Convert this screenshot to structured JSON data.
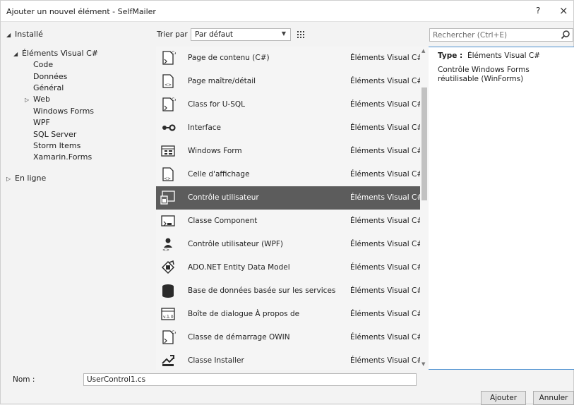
{
  "window": {
    "title": "Ajouter un nouvel élément - SelfMailer",
    "help": "?",
    "close": "×"
  },
  "tree": {
    "installed": "Installé",
    "visual_csharp": "Éléments Visual C#",
    "children": [
      "Code",
      "Données",
      "Général",
      "Web",
      "Windows Forms",
      "WPF",
      "SQL Server",
      "Storm Items",
      "Xamarin.Forms"
    ],
    "online": "En ligne"
  },
  "toolbar": {
    "sort_label": "Trier par :",
    "sort_value": "Par défaut"
  },
  "search": {
    "placeholder": "Rechercher (Ctrl+E)"
  },
  "templates": [
    {
      "name": "Page de contenu (C#)",
      "category": "Éléments Visual C#",
      "icon": "content-page-icon"
    },
    {
      "name": "Page maître/détail",
      "category": "Éléments Visual C#",
      "icon": "master-detail-icon"
    },
    {
      "name": "Class for U-SQL",
      "category": "Éléments Visual C#",
      "icon": "usql-class-icon"
    },
    {
      "name": "Interface",
      "category": "Éléments Visual C#",
      "icon": "interface-icon"
    },
    {
      "name": "Windows Form",
      "category": "Éléments Visual C#",
      "icon": "windows-form-icon"
    },
    {
      "name": "Celle d'affichage",
      "category": "Éléments Visual C#",
      "icon": "view-cell-icon"
    },
    {
      "name": "Contrôle utilisateur",
      "category": "Éléments Visual C#",
      "icon": "user-control-icon",
      "selected": true
    },
    {
      "name": "Classe Component",
      "category": "Éléments Visual C#",
      "icon": "component-class-icon"
    },
    {
      "name": "Contrôle utilisateur (WPF)",
      "category": "Éléments Visual C#",
      "icon": "wpf-user-control-icon"
    },
    {
      "name": "ADO.NET Entity Data Model",
      "category": "Éléments Visual C#",
      "icon": "entity-data-model-icon"
    },
    {
      "name": "Base de données basée sur les services",
      "category": "Éléments Visual C#",
      "icon": "database-icon"
    },
    {
      "name": "Boîte de dialogue À propos de",
      "category": "Éléments Visual C#",
      "icon": "about-box-icon"
    },
    {
      "name": "Classe de démarrage OWIN",
      "category": "Éléments Visual C#",
      "icon": "owin-startup-icon"
    },
    {
      "name": "Classe Installer",
      "category": "Éléments Visual C#",
      "icon": "installer-class-icon"
    }
  ],
  "details": {
    "type_label": "Type :",
    "type_value": "Éléments Visual C#",
    "description": "Contrôle Windows Forms réutilisable (WinForms)"
  },
  "footer": {
    "name_label": "Nom :",
    "name_value": "UserControl1.cs",
    "add_label": "Ajouter",
    "cancel_label": "Annuler"
  },
  "colors": {
    "selection": "#5c5c5c",
    "accent": "#4a8fd0",
    "window_bg": "#f3f3f3"
  }
}
